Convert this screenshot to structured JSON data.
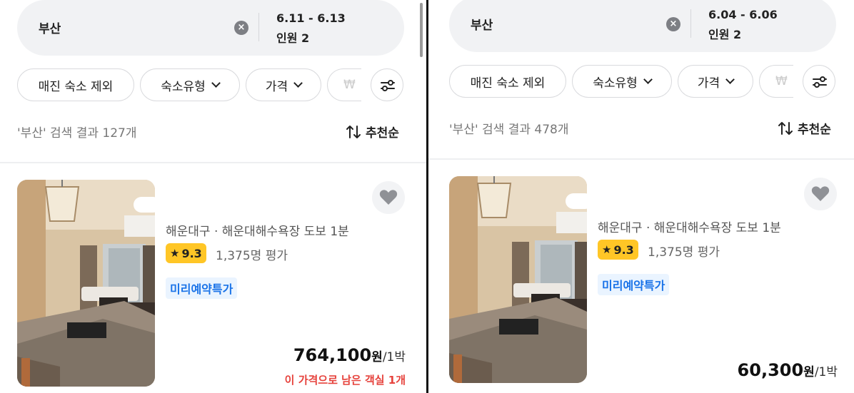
{
  "left": {
    "search": {
      "city": "부산",
      "dates": "6.11 - 6.13",
      "guests": "인원 2"
    },
    "filters": [
      "매진 숙소 제외",
      "숙소유형",
      "가격",
      "₩"
    ],
    "result_count": "'부산' 검색 결과 127개",
    "sort_label": "추천순",
    "listing": {
      "location": "해운대구 · 해운대해수욕장 도보 1분",
      "rating": "9.3",
      "reviews": "1,375명 평가",
      "tag": "미리예약특가",
      "price_amount": "764,100",
      "price_unit": "원",
      "price_per": "/1박",
      "remaining": "이 가격으로 남은 객실 1개"
    }
  },
  "right": {
    "search": {
      "city": "부산",
      "dates": "6.04 - 6.06",
      "guests": "인원 2"
    },
    "filters": [
      "매진 숙소 제외",
      "숙소유형",
      "가격",
      "₩"
    ],
    "result_count": "'부산' 검색 결과 478개",
    "sort_label": "추천순",
    "listing": {
      "location": "해운대구 · 해운대해수욕장 도보 1분",
      "rating": "9.3",
      "reviews": "1,375명 평가",
      "tag": "미리예약특가",
      "price_amount": "60,300",
      "price_unit": "원",
      "price_per": "/1박"
    }
  },
  "colors": {
    "rating_badge": "#ffc626",
    "tag_bg": "#eaf4ff",
    "tag_text": "#1a73e8",
    "warning": "#e6423c"
  },
  "icons": {
    "clear": "clear-x-circle-icon",
    "chevron": "chevron-down-icon",
    "filter": "sliders-icon",
    "sort": "sort-arrows-icon",
    "heart": "heart-icon",
    "star": "star-icon"
  }
}
